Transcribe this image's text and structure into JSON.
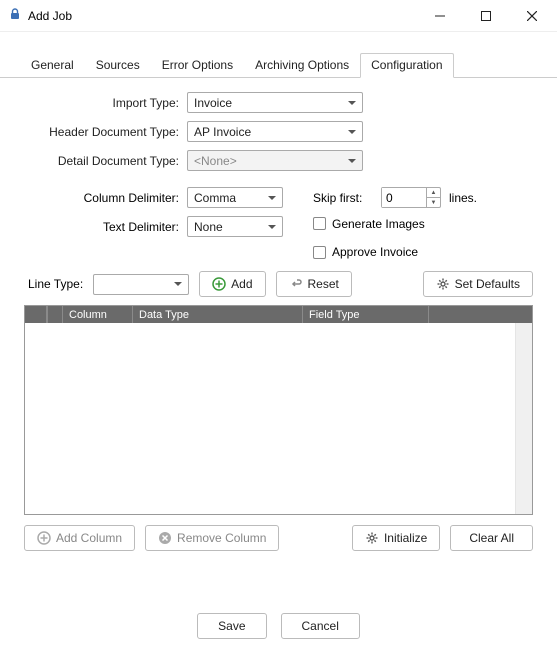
{
  "title": "Add Job",
  "tabs": {
    "general": "General",
    "sources": "Sources",
    "errorOptions": "Error Options",
    "archivingOptions": "Archiving Options",
    "configuration": "Configuration"
  },
  "labels": {
    "importType": "Import Type:",
    "headerDocType": "Header Document Type:",
    "detailDocType": "Detail Document Type:",
    "columnDelimiter": "Column Delimiter:",
    "textDelimiter": "Text Delimiter:",
    "skipFirst": "Skip first:",
    "lines": "lines.",
    "generateImages": "Generate Images",
    "approveInvoice": "Approve Invoice",
    "lineType": "Line Type:"
  },
  "values": {
    "importType": "Invoice",
    "headerDocType": "AP Invoice",
    "detailDocType": "<None>",
    "columnDelimiter": "Comma",
    "textDelimiter": "None",
    "skipFirst": "0",
    "lineType": ""
  },
  "buttons": {
    "add": "Add",
    "reset": "Reset",
    "setDefaults": "Set Defaults",
    "addColumn": "Add Column",
    "removeColumn": "Remove Column",
    "initialize": "Initialize",
    "clearAll": "Clear All",
    "save": "Save",
    "cancel": "Cancel"
  },
  "columns": {
    "column": "Column",
    "dataType": "Data Type",
    "fieldType": "Field Type"
  }
}
